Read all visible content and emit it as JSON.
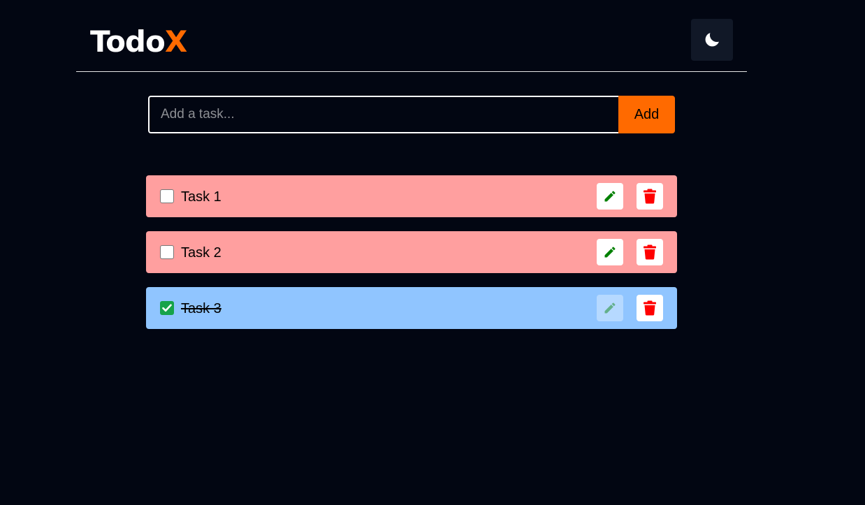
{
  "app": {
    "logo_main": "Todo",
    "logo_accent": "X",
    "theme_icon": "moon-icon"
  },
  "add_form": {
    "placeholder": "Add a task...",
    "value": "",
    "add_label": "Add"
  },
  "tasks": [
    {
      "label": "Task 1",
      "completed": false
    },
    {
      "label": "Task 2",
      "completed": false
    },
    {
      "label": "Task 3",
      "completed": true
    }
  ],
  "colors": {
    "background": "#020612",
    "accent": "#ff6a00",
    "pending_task": "#ff9f9f",
    "completed_task": "#90c5ff",
    "edit_icon": "#008000",
    "delete_icon": "#ff0000",
    "check_green": "#16a34a"
  },
  "icons": {
    "edit": "pencil-icon",
    "delete": "trash-icon",
    "checkmark": "checkmark-icon"
  }
}
